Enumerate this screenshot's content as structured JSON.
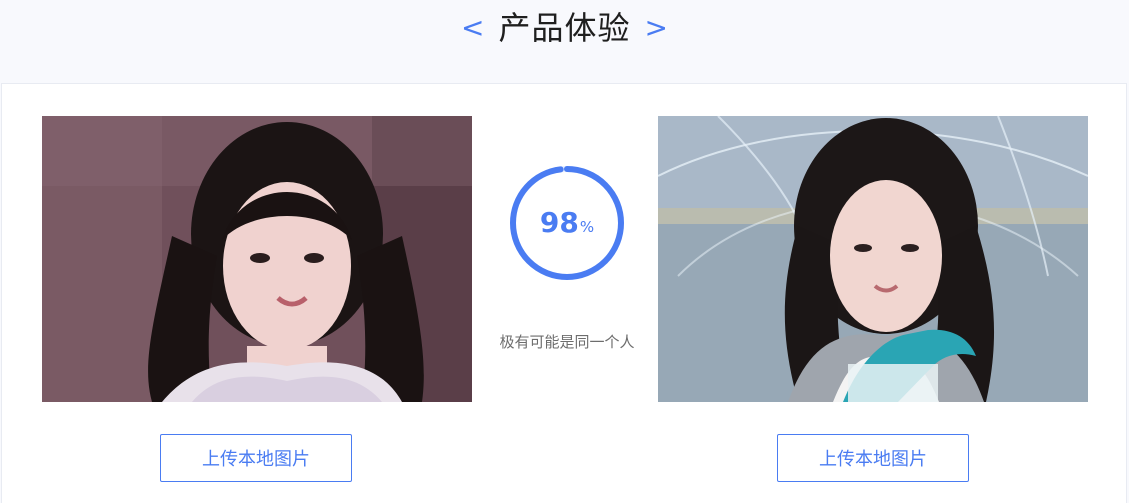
{
  "header": {
    "title": "产品体验",
    "left_chevron": "<",
    "right_chevron": ">"
  },
  "comparison": {
    "score_value": "98",
    "score_unit": "%",
    "score_fraction": 0.98,
    "result_text": "极有可能是同一个人"
  },
  "buttons": {
    "upload_left_label": "上传本地图片",
    "upload_right_label": "上传本地图片"
  },
  "icons": {
    "left_chevron": "chevron-left-icon",
    "right_chevron": "chevron-right-icon"
  },
  "colors": {
    "accent": "#4a7cf2",
    "text_dark": "#1f1f1f",
    "text_muted": "#6d6d6d",
    "page_bg": "#f8f9fd",
    "panel_bg": "#ffffff"
  }
}
